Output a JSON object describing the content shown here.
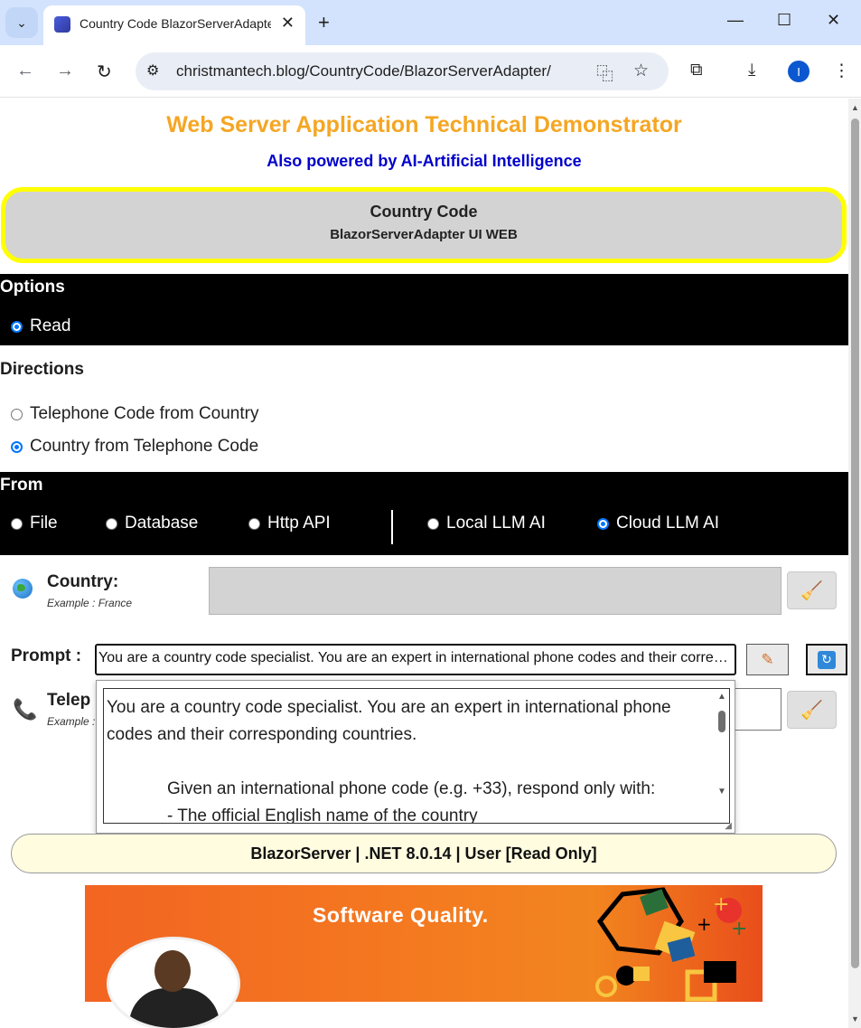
{
  "browser": {
    "tab_title": "Country Code BlazorServerAdapter",
    "url": "christmantech.blog/CountryCode/BlazorServerAdapter/",
    "profile_initial": "I"
  },
  "page": {
    "title": "Web Server Application Technical Demonstrator",
    "subtitle": "Also powered by AI-Artificial Intelligence",
    "banner": {
      "title": "Country Code",
      "subtitle": "BlazorServerAdapter UI WEB"
    },
    "options": {
      "heading": "Options",
      "items": [
        {
          "label": "Read",
          "checked": true
        }
      ]
    },
    "directions": {
      "heading": "Directions",
      "items": [
        {
          "label": "Telephone Code from Country",
          "checked": false
        },
        {
          "label": "Country from Telephone Code",
          "checked": true
        }
      ]
    },
    "from": {
      "heading": "From",
      "items": [
        {
          "label": "File",
          "checked": false
        },
        {
          "label": "Database",
          "checked": false
        },
        {
          "label": "Http API",
          "checked": false
        },
        {
          "label": "Local LLM AI",
          "checked": false
        },
        {
          "label": "Cloud LLM AI",
          "checked": true
        }
      ]
    },
    "country": {
      "label": "Country:",
      "example": "Example : France",
      "value": ""
    },
    "prompt": {
      "label": "Prompt :",
      "value": "You are a country code specialist. You are an expert in international phone codes and their corresponding countries."
    },
    "telephone": {
      "label": "Telep",
      "example": "Example :"
    },
    "prompt_popup": {
      "line1": "You are a country code specialist. You are an expert in international phone codes and their corresponding countries.",
      "line2": "Given an international phone code (e.g. +33), respond only with:",
      "line3": "- The official English name of the country"
    },
    "footer": "BlazorServer | .NET 8.0.14 | User [Read Only]",
    "ad_text": "Software Quality."
  },
  "colors": {
    "title": "#f5a623",
    "subtitle": "#0000cc",
    "banner_border": "#ffff00",
    "accent": "#0075ff"
  }
}
